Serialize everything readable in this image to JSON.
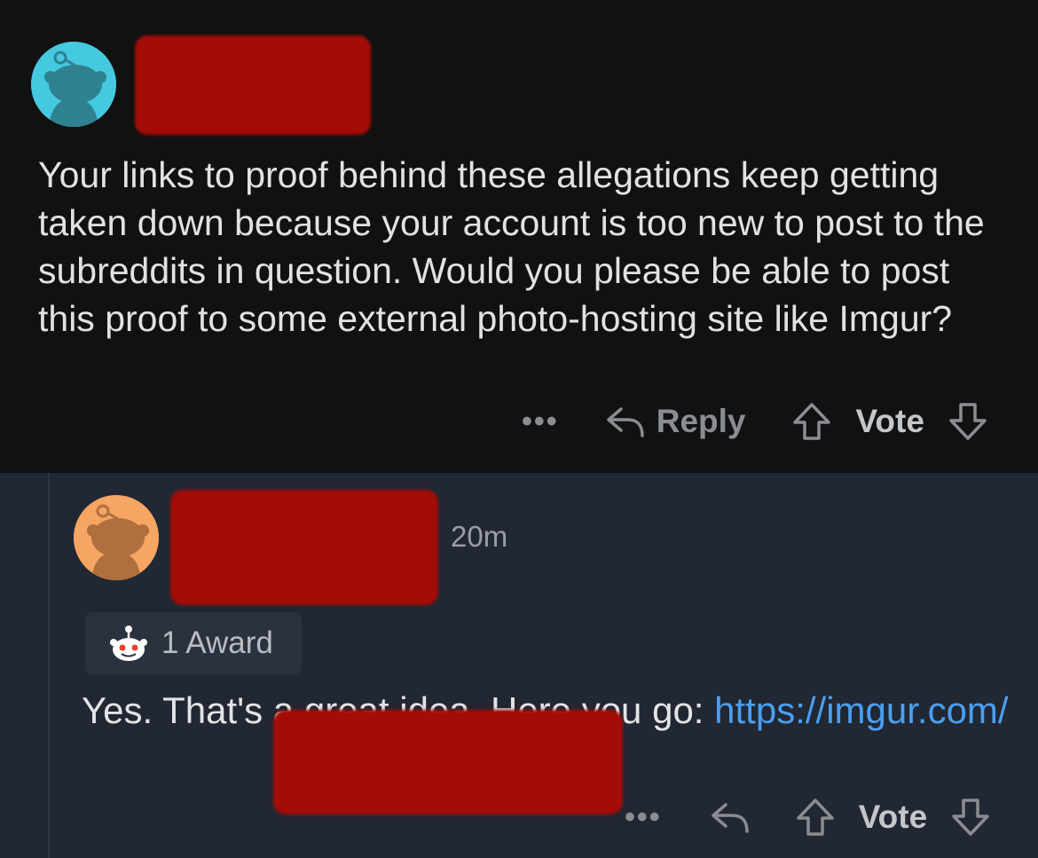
{
  "comment_1": {
    "body": "Your links to proof behind these allegations keep getting taken down because your account is too new to post to the subreddits in question. Would you please be able to post this proof to some external photo-hosting site like Imgur?",
    "actions": {
      "more": "•••",
      "reply": "Reply",
      "vote": "Vote"
    }
  },
  "comment_2": {
    "timestamp": "20m",
    "award": "1 Award",
    "body_prefix": "Yes.  That's a great idea.  Here you go: ",
    "link_text": "https://imgur.com/",
    "actions": {
      "more": "•••",
      "vote": "Vote"
    }
  },
  "colors": {
    "avatar_1_bg": "#44c9e1",
    "avatar_2_bg": "#f6a563",
    "redaction": "#a40d07",
    "link": "#4a9ff0"
  },
  "icons": [
    "snoo-avatar-icon",
    "reply-arrow-icon",
    "upvote-icon",
    "downvote-icon",
    "award-icon"
  ]
}
